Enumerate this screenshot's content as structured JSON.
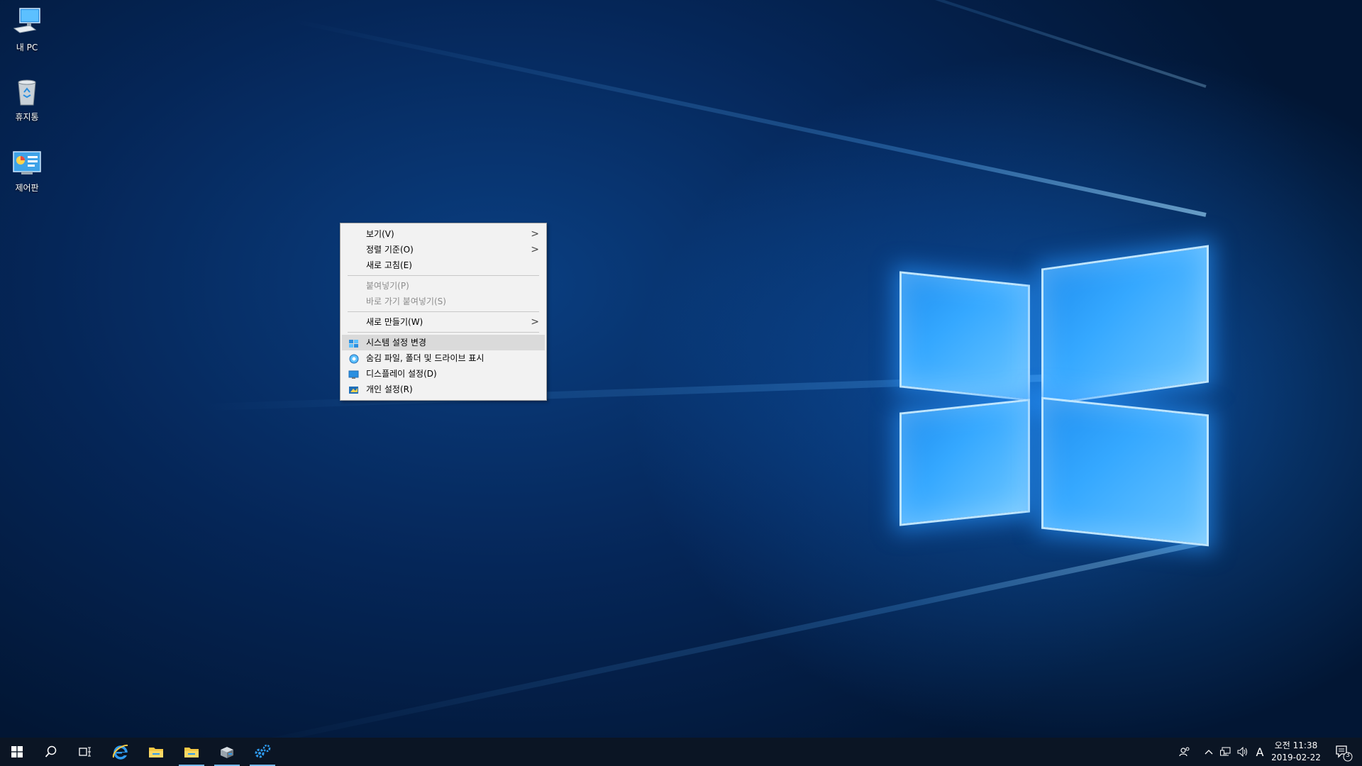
{
  "desktop": {
    "icons": [
      {
        "label": "내 PC",
        "icon": "this-pc-icon"
      },
      {
        "label": "휴지통",
        "icon": "recycle-bin-icon"
      },
      {
        "label": "제어판",
        "icon": "control-panel-icon"
      }
    ]
  },
  "context_menu": {
    "items": [
      {
        "label": "보기(V)",
        "submenu": true
      },
      {
        "label": "정렬 기준(O)",
        "submenu": true
      },
      {
        "label": "새로 고침(E)"
      },
      {
        "label": "붙여넣기(P)",
        "disabled": true
      },
      {
        "label": "바로 가기 붙여넣기(S)",
        "disabled": true
      },
      {
        "label": "새로 만들기(W)",
        "submenu": true
      },
      {
        "label": "시스템 설정 변경",
        "icon": "system-settings-icon",
        "highlighted": true
      },
      {
        "label": "숨김 파일, 폴더 및 드라이브 표시",
        "icon": "show-hidden-icon"
      },
      {
        "label": "디스플레이 설정(D)",
        "icon": "display-icon"
      },
      {
        "label": "개인 설정(R)",
        "icon": "personalize-icon"
      }
    ],
    "submenu_glyph": ">"
  },
  "taskbar": {
    "buttons": [
      "start-icon",
      "search-icon",
      "task-view-icon",
      "internet-explorer-icon",
      "file-explorer-icon",
      "file-explorer-icon",
      "server-manager-icon",
      "settings-gear-icon"
    ],
    "tray": {
      "ime_label": "A",
      "clock_time": "오전 11:38",
      "clock_date": "2019-02-22",
      "notification_count": "3"
    }
  },
  "colors": {
    "accent": "#76b9ed",
    "taskbar": "#0b1524",
    "menu_bg": "#f2f2f2",
    "menu_highlight": "#dadada"
  }
}
